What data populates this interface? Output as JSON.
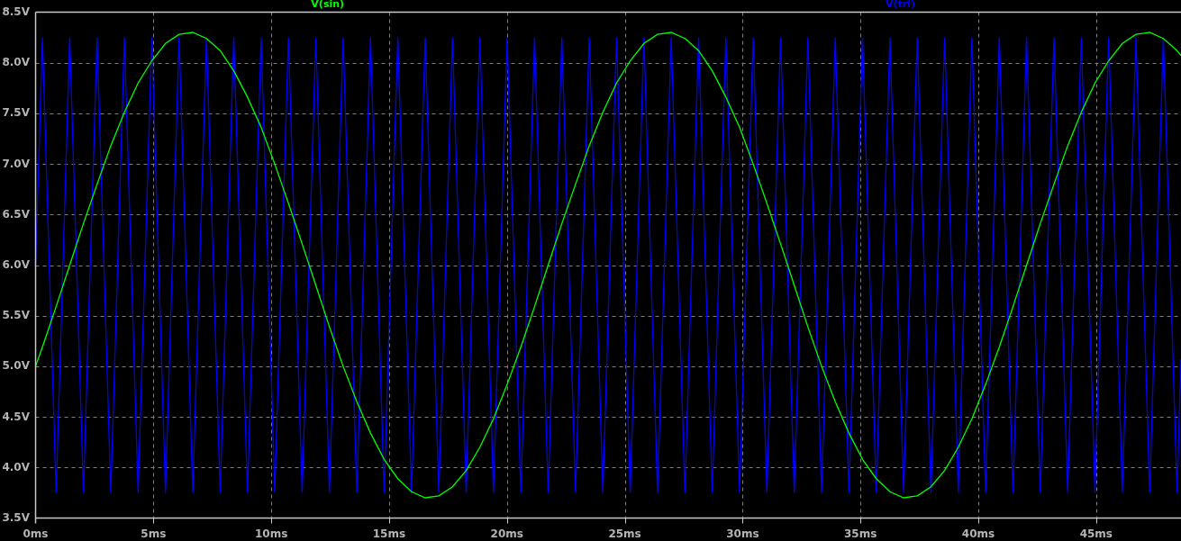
{
  "chart_data": {
    "type": "line",
    "grid": true,
    "xlim": [
      0,
      48.6
    ],
    "ylim": [
      3.5,
      8.5
    ],
    "xticks": [
      {
        "value": 0,
        "label": "0ms"
      },
      {
        "value": 5,
        "label": "5ms"
      },
      {
        "value": 10,
        "label": "10ms"
      },
      {
        "value": 15,
        "label": "15ms"
      },
      {
        "value": 20,
        "label": "20ms"
      },
      {
        "value": 25,
        "label": "25ms"
      },
      {
        "value": 30,
        "label": "30ms"
      },
      {
        "value": 35,
        "label": "35ms"
      },
      {
        "value": 40,
        "label": "40ms"
      },
      {
        "value": 45,
        "label": "45ms"
      }
    ],
    "yticks": [
      {
        "value": 3.5,
        "label": "3.5V"
      },
      {
        "value": 4.0,
        "label": "4.0V"
      },
      {
        "value": 4.5,
        "label": "4.5V"
      },
      {
        "value": 5.0,
        "label": "5.0V"
      },
      {
        "value": 5.5,
        "label": "5.5V"
      },
      {
        "value": 6.0,
        "label": "6.0V"
      },
      {
        "value": 6.5,
        "label": "6.5V"
      },
      {
        "value": 7.0,
        "label": "7.0V"
      },
      {
        "value": 7.5,
        "label": "7.5V"
      },
      {
        "value": 8.0,
        "label": "8.0V"
      },
      {
        "value": 8.5,
        "label": "8.5V"
      }
    ],
    "x": [
      0,
      0.29,
      0.87,
      1.45,
      2.03,
      2.61,
      3.19,
      3.77,
      4.35,
      4.93,
      5.51,
      6.09,
      6.67,
      7.25,
      7.83,
      8.41,
      8.99,
      9.57,
      10.15,
      10.73,
      11.31,
      11.89,
      12.47,
      13.05,
      13.63,
      14.21,
      14.79,
      15.37,
      15.95,
      16.53,
      17.11,
      17.69,
      18.27,
      18.85,
      19.43,
      20.01,
      20.59,
      21.17,
      21.75,
      22.33,
      22.91,
      23.49,
      24.07,
      24.65,
      25.23,
      25.81,
      26.39,
      26.97,
      27.55,
      28.13,
      28.71,
      29.29,
      29.87,
      30.45,
      31.03,
      31.61,
      32.19,
      32.77,
      33.35,
      33.93,
      34.51,
      35.09,
      35.67,
      36.25,
      36.83,
      37.41,
      37.99,
      38.57,
      39.15,
      39.73,
      40.31,
      40.89,
      41.47,
      42.05,
      42.63,
      43.21,
      43.79,
      44.37,
      44.95,
      45.53,
      46.11,
      46.69,
      47.27,
      47.85,
      48.43,
      48.6
    ],
    "series": [
      {
        "name": "V(sin)",
        "color": "#00ff00",
        "values": [
          5.0,
          5.19,
          5.59,
          6.0,
          6.41,
          6.8,
          7.18,
          7.51,
          7.8,
          8.02,
          8.19,
          8.28,
          8.3,
          8.24,
          8.12,
          7.92,
          7.66,
          7.36,
          7.0,
          6.61,
          6.21,
          5.8,
          5.39,
          5.0,
          4.65,
          4.34,
          4.08,
          3.89,
          3.76,
          3.7,
          3.72,
          3.81,
          3.97,
          4.2,
          4.48,
          4.82,
          5.19,
          5.59,
          6.0,
          6.41,
          6.8,
          7.18,
          7.51,
          7.8,
          8.02,
          8.19,
          8.28,
          8.3,
          8.24,
          8.12,
          7.92,
          7.66,
          7.36,
          7.0,
          6.61,
          6.21,
          5.8,
          5.39,
          5.0,
          4.65,
          4.34,
          4.08,
          3.89,
          3.76,
          3.7,
          3.72,
          3.81,
          3.97,
          4.2,
          4.48,
          4.82,
          5.19,
          5.59,
          6.0,
          6.41,
          6.8,
          7.18,
          7.51,
          7.8,
          8.02,
          8.19,
          8.28,
          8.3,
          8.24,
          8.12,
          8.07
        ]
      },
      {
        "name": "V(tri)",
        "color": "#0000ff",
        "values": [
          6.0,
          8.25,
          3.75,
          8.25,
          3.75,
          8.25,
          3.75,
          8.25,
          3.75,
          8.25,
          3.75,
          8.25,
          3.75,
          8.25,
          3.75,
          8.25,
          3.75,
          8.25,
          3.75,
          8.25,
          3.75,
          8.25,
          3.75,
          8.25,
          3.75,
          8.25,
          3.75,
          8.25,
          3.75,
          8.25,
          3.75,
          8.25,
          3.75,
          8.25,
          3.75,
          8.25,
          3.75,
          8.25,
          3.75,
          8.25,
          3.75,
          8.25,
          3.75,
          8.25,
          3.75,
          8.25,
          3.75,
          8.25,
          3.75,
          8.25,
          3.75,
          8.25,
          3.75,
          8.25,
          3.75,
          8.25,
          3.75,
          8.25,
          3.75,
          8.25,
          3.75,
          8.25,
          3.75,
          8.25,
          3.75,
          8.25,
          3.75,
          8.25,
          3.75,
          8.25,
          3.75,
          8.25,
          3.75,
          8.25,
          3.75,
          8.25,
          3.75,
          8.25,
          3.75,
          8.25,
          3.75,
          8.25,
          3.75,
          8.25,
          3.75,
          5.07
        ]
      }
    ]
  }
}
